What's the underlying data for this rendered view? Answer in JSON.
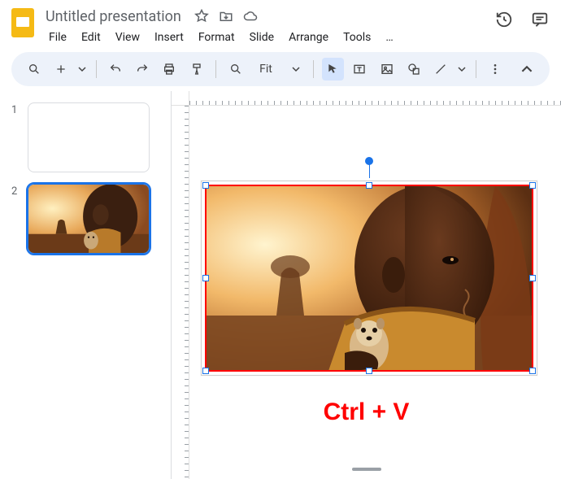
{
  "header": {
    "title": "Untitled presentation",
    "menus": [
      "File",
      "Edit",
      "View",
      "Insert",
      "Format",
      "Slide",
      "Arrange",
      "Tools",
      "…"
    ]
  },
  "toolbar": {
    "zoom_label": "Fit"
  },
  "thumbnails": [
    {
      "num": "1",
      "selected": false,
      "has_image": false
    },
    {
      "num": "2",
      "selected": true,
      "has_image": true
    }
  ],
  "annotation": "Ctrl + V"
}
